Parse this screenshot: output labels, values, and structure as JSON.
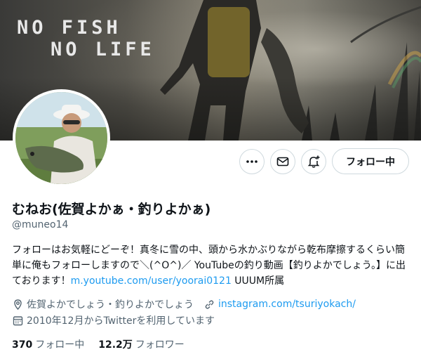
{
  "banner": {
    "line1": "NO FISH",
    "line2": "NO LIFE"
  },
  "profile": {
    "display_name": "むねお(佐賀よかぁ・釣りよかぁ)",
    "handle": "@muneo14",
    "bio_text": "フォローはお気軽にどーぞ！真冬に雪の中、頭から水かぶりながら乾布摩擦するくらい簡単に俺もフォローしますので＼(^O^)／ YouTubeの釣り動画【釣りよかでしょう。】に出ております！",
    "bio_link": "m.youtube.com/user/yoorai0121",
    "bio_suffix": " UUUM所属",
    "location": "佐賀よかでしょう・釣りよかでしょう",
    "website": "instagram.com/tsuriyokach/",
    "joined": "2010年12月からTwitterを利用しています"
  },
  "actions": {
    "more_icon": "more-icon",
    "message_icon": "mail-icon",
    "notify_icon": "bell-plus-icon",
    "follow_label": "フォロー中"
  },
  "stats": {
    "following_count": "370",
    "following_label": "フォロー中",
    "followers_count": "12.2万",
    "followers_label": "フォロワー"
  },
  "colors": {
    "link": "#1d9bf0",
    "secondary_text": "#536471",
    "primary_text": "#0f1419",
    "border": "#cfd9de"
  }
}
